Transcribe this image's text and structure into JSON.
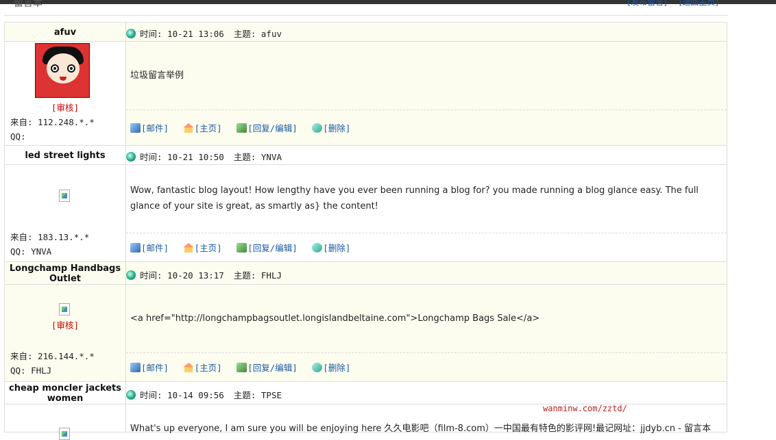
{
  "header": {
    "title": "留言本",
    "link_post": "[发布留言]",
    "link_home": "[返回主页]"
  },
  "entries": [
    {
      "name": "afuv",
      "time": "时间: 10-21 13:06",
      "subject": "主题: afuv",
      "message": "垃圾留言举例",
      "audit": "[审核]",
      "from": "来自: 112.248.*.*",
      "qq": "QQ:",
      "avatar": "pucca-avatar"
    },
    {
      "name": "led street lights",
      "time": "时间: 10-21 10:50",
      "subject": "主题: YNVA",
      "message": "Wow, fantastic blog layout! How lengthy have you ever been running a blog for? you made running a blog glance easy. The full glance of your site is great, as smartly as} the content!",
      "audit": "",
      "from": "来自: 183.13.*.*",
      "qq": "QQ: YNVA",
      "avatar": "broken-image"
    },
    {
      "name": "Longchamp Handbags Outlet",
      "time": "时间: 10-20 13:17",
      "subject": "主题: FHLJ",
      "message": "<a href=\"http://longchampbagsoutlet.longislandbeltaine.com\">Longchamp Bags Sale</a>",
      "audit": "[审核]",
      "from": "来自: 216.144.*.*",
      "qq": "QQ: FHLJ",
      "avatar": "broken-image"
    },
    {
      "name": "cheap moncler jackets women",
      "time": "时间: 10-14 09:56",
      "subject": "主题: TPSE",
      "message": "What's up everyone, I am sure you will be enjoying here 久久电影吧（film-8.com）一中国最有特色的影评网!最记网址：jjdyb.cn - 留言本",
      "avatar": "broken-image"
    }
  ],
  "actions": {
    "mail": "[邮件]",
    "homepage": "[主页]",
    "reply_edit": "[回复/编辑]",
    "delete": "[删除]"
  },
  "watermark": "wanminw.com/zztd/"
}
